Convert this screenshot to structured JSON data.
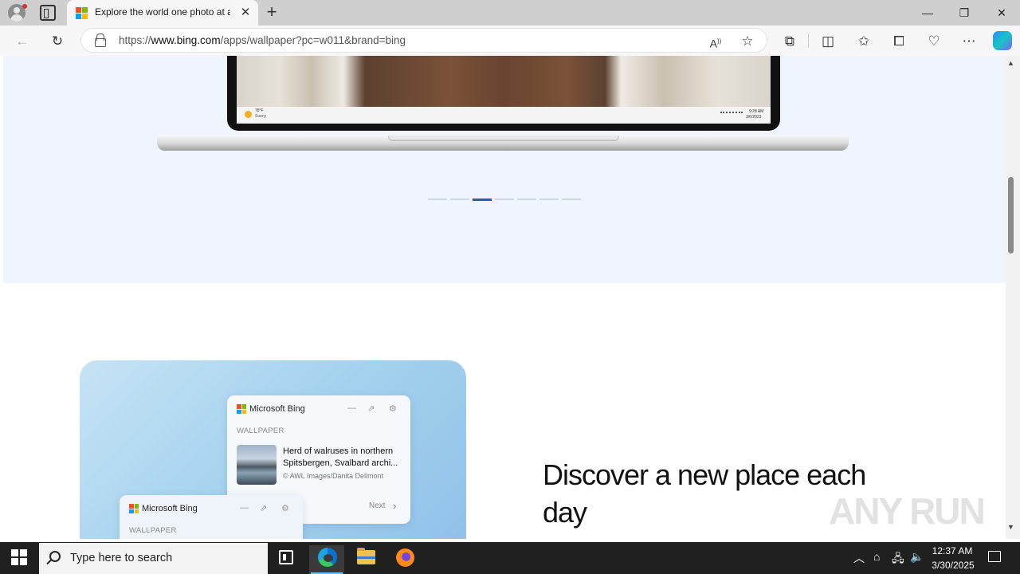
{
  "browser": {
    "tab_title": "Explore the world one photo at a",
    "tab_close": "✕",
    "new_tab": "+",
    "url_prefix": "https://",
    "url_host": "www.bing.com",
    "url_path": "/apps/wallpaper?pc=w011&brand=bing",
    "window_minimize": "—",
    "window_restore": "❐",
    "window_close": "✕"
  },
  "hero": {
    "mini_weather_temp": "78°F",
    "mini_weather_condition": "Sunny",
    "mini_time": "9:28 AM",
    "mini_date": "3/6/2023",
    "carousel_count": 7,
    "carousel_active_index": 2
  },
  "feature": {
    "widget_app_name": "Microsoft Bing",
    "widget_section": "WALLPAPER",
    "photo_title_line1": "Herd of walruses in northern",
    "photo_title_line2": "Spitsbergen, Svalbard archi...",
    "photo_credit": "© AWL Images/Danita Delimont",
    "next_label": "Next",
    "heading": "Discover a new place each day"
  },
  "watermark": "ANY RUN",
  "taskbar": {
    "search_placeholder": "Type here to search",
    "time": "12:37 AM",
    "date": "3/30/2025"
  },
  "colors": {
    "carousel_active": "#1e62b6",
    "hero_bg": "#f0f5fd",
    "taskbar_bg": "#202020"
  }
}
